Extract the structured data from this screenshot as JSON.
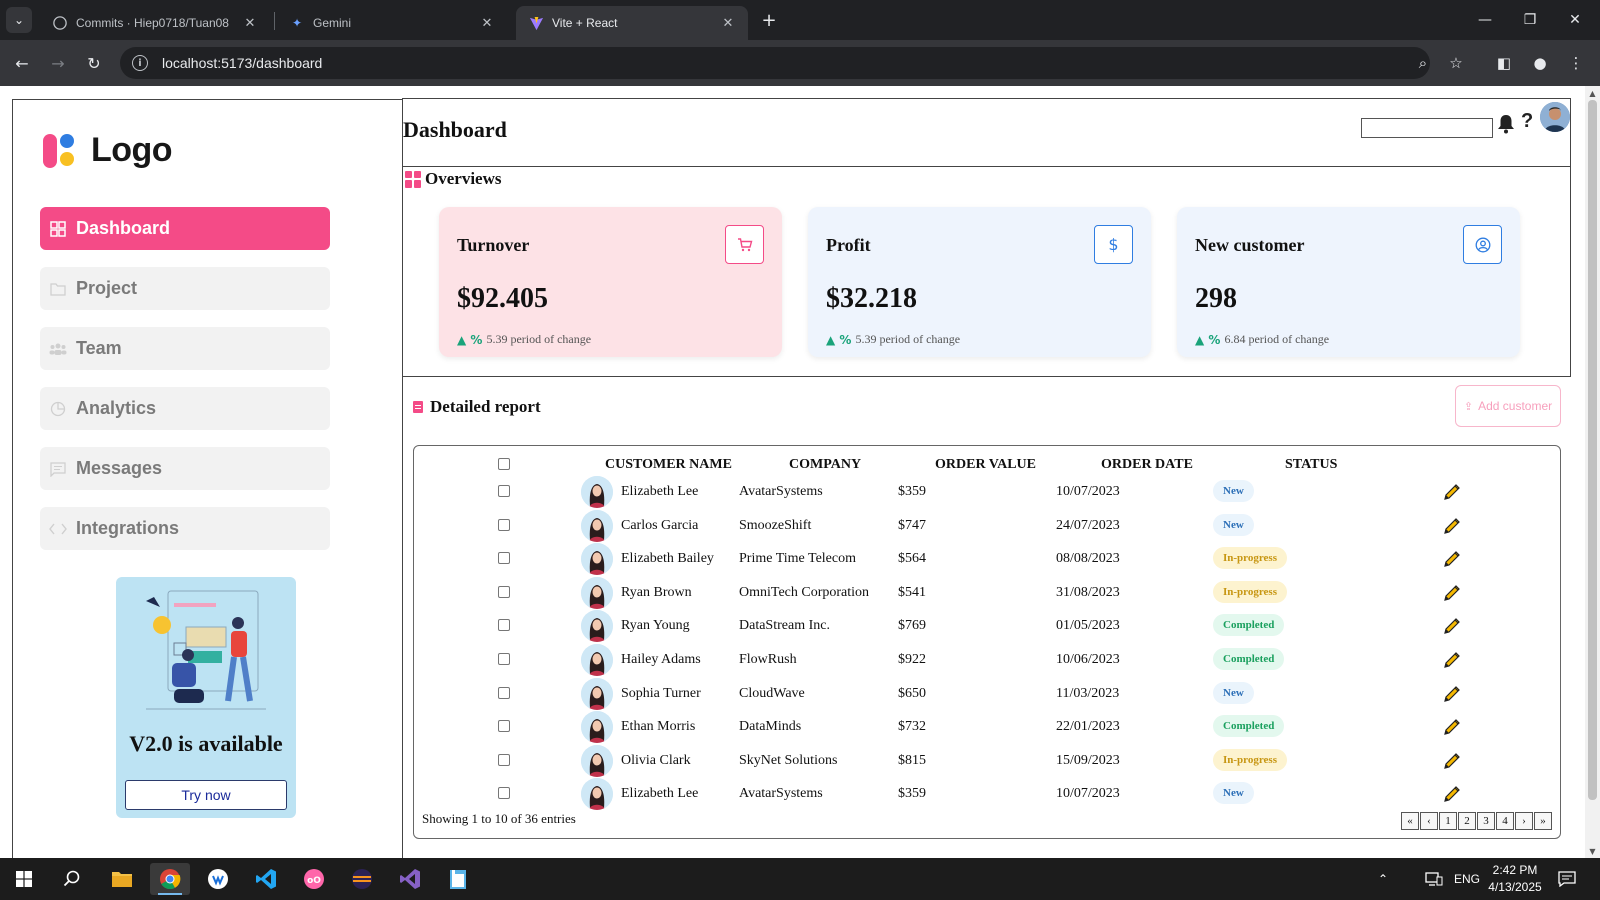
{
  "browser": {
    "tabs": [
      {
        "title": "Commits · Hiep0718/Tuan08",
        "icon": "github-icon"
      },
      {
        "title": "Gemini",
        "icon": "gemini-icon"
      },
      {
        "title": "Vite + React",
        "icon": "vite-icon",
        "active": true
      }
    ],
    "url": "localhost:5173/dashboard"
  },
  "sidebar": {
    "logo_text": "Logo",
    "nav": [
      {
        "label": "Dashboard",
        "icon": "grid-icon",
        "active": true
      },
      {
        "label": "Project",
        "icon": "folder-icon"
      },
      {
        "label": "Team",
        "icon": "team-icon"
      },
      {
        "label": "Analytics",
        "icon": "pie-chart-icon"
      },
      {
        "label": "Messages",
        "icon": "message-icon"
      },
      {
        "label": "Integrations",
        "icon": "code-icon"
      }
    ],
    "promo": {
      "title": "V2.0 is available",
      "button": "Try now"
    }
  },
  "header": {
    "title": "Dashboard",
    "search_value": ""
  },
  "overview": {
    "title": "Overviews",
    "cards": [
      {
        "label": "Turnover",
        "value": "$92.405",
        "percent_symbol": "%",
        "change_text": "5.39 period of change",
        "icon": "cart-icon",
        "color": "#f44b87"
      },
      {
        "label": "Profit",
        "value": "$32.218",
        "percent_symbol": "%",
        "change_text": "5.39 period of change",
        "icon": "dollar-icon",
        "color": "#2f7de1"
      },
      {
        "label": "New customer",
        "value": "298",
        "percent_symbol": "%",
        "change_text": "6.84 period of change",
        "icon": "user-icon",
        "color": "#2f7de1"
      }
    ]
  },
  "report": {
    "title": "Detailed report",
    "add_button": "Add customer",
    "columns": [
      "CUSTOMER NAME",
      "COMPANY",
      "ORDER VALUE",
      "ORDER DATE",
      "STATUS"
    ],
    "rows": [
      {
        "name": "Elizabeth Lee",
        "company": "AvatarSystems",
        "value": "$359",
        "date": "10/07/2023",
        "status": "New"
      },
      {
        "name": "Carlos Garcia",
        "company": "SmoozeShift",
        "value": "$747",
        "date": "24/07/2023",
        "status": "New"
      },
      {
        "name": "Elizabeth Bailey",
        "company": "Prime Time Telecom",
        "value": "$564",
        "date": "08/08/2023",
        "status": "In-progress"
      },
      {
        "name": "Ryan Brown",
        "company": "OmniTech Corporation",
        "value": "$541",
        "date": "31/08/2023",
        "status": "In-progress"
      },
      {
        "name": "Ryan Young",
        "company": "DataStream Inc.",
        "value": "$769",
        "date": "01/05/2023",
        "status": "Completed"
      },
      {
        "name": "Hailey Adams",
        "company": "FlowRush",
        "value": "$922",
        "date": "10/06/2023",
        "status": "Completed"
      },
      {
        "name": "Sophia Turner",
        "company": "CloudWave",
        "value": "$650",
        "date": "11/03/2023",
        "status": "New"
      },
      {
        "name": "Ethan Morris",
        "company": "DataMinds",
        "value": "$732",
        "date": "22/01/2023",
        "status": "Completed"
      },
      {
        "name": "Olivia Clark",
        "company": "SkyNet Solutions",
        "value": "$815",
        "date": "15/09/2023",
        "status": "In-progress"
      },
      {
        "name": "Elizabeth Lee",
        "company": "AvatarSystems",
        "value": "$359",
        "date": "10/07/2023",
        "status": "New"
      }
    ],
    "footer": "Showing 1 to 10 of 36 entries",
    "pager": [
      "«",
      "‹",
      "1",
      "2",
      "3",
      "4",
      "›",
      "»"
    ]
  },
  "taskbar": {
    "apps": [
      "start-icon",
      "search-icon",
      "file-explorer-icon",
      "chrome-icon",
      "app-icon",
      "vscode-icon",
      "osu-icon",
      "eclipse-icon",
      "visual-studio-icon",
      "notepad-icon"
    ],
    "lang": "ENG",
    "time": "2:42 PM",
    "date": "4/13/2025"
  }
}
